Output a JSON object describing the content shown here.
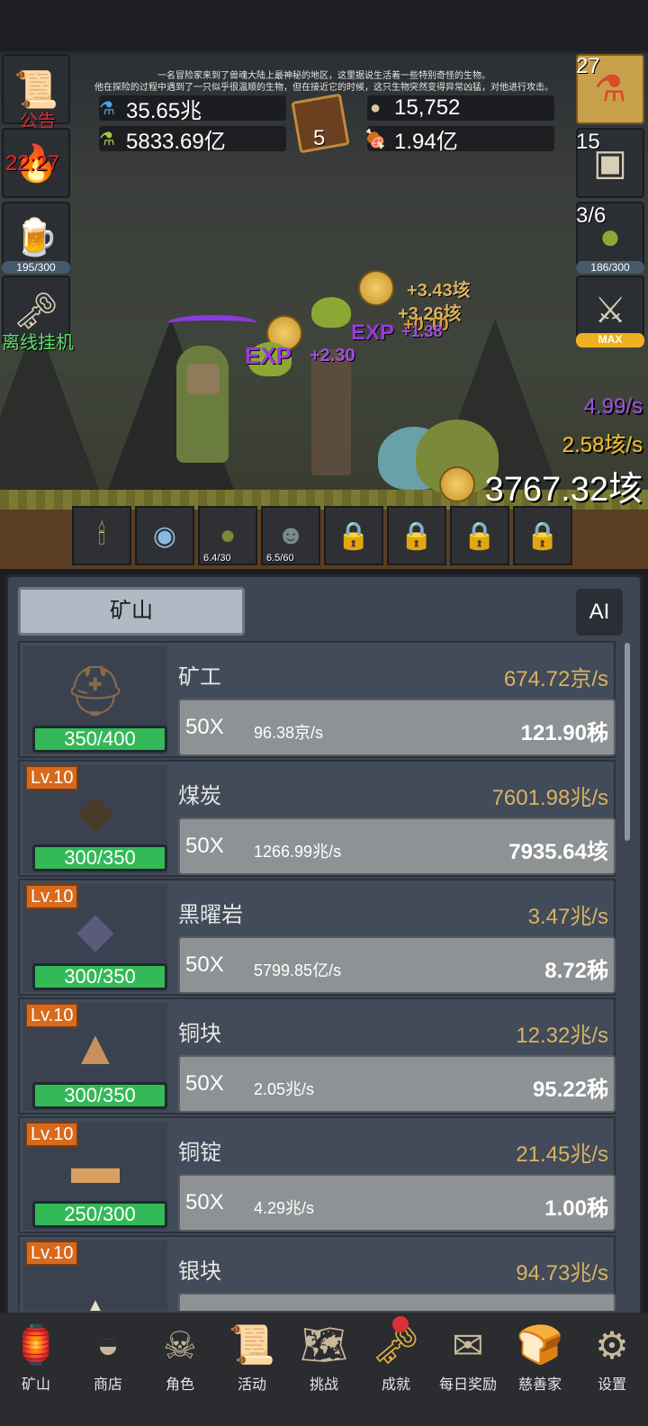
{
  "story": {
    "line1": "一名冒险家来到了兽魂大陆上最神秘的地区，这里据说生活着一些特别奇怪的生物。",
    "line2": "他在探险的过程中遇到了一只似乎很温顺的生物，但在接近它的时候，这只生物突然变得异常凶猛，对他进行攻击。"
  },
  "resources": {
    "blue_potion": "35.65兆",
    "green_potion": "5833.69亿",
    "coin": "15,752",
    "meat": "1.94亿",
    "book_count": "5"
  },
  "left_buttons": {
    "notice_label": "公告",
    "timer": "22:27",
    "beer_progress": "195/300",
    "offline_label": "离线挂机"
  },
  "right_buttons": {
    "potion_count": "27",
    "chest_count": "15",
    "slime_count": "3/6",
    "slime_progress": "186/300",
    "sword_max": "MAX"
  },
  "battle": {
    "exp_rate": "4.99/s",
    "gold_rate": "2.58垓/s",
    "gold_total": "3767.32垓",
    "floats": [
      {
        "text": "+3.43垓",
        "color": "#d9b262"
      },
      {
        "text": "+3.26垓",
        "color": "#d9b262"
      },
      {
        "text": "+0.10",
        "color": "#e09a3a"
      },
      {
        "text": "+1.38",
        "color": "#a050e0"
      },
      {
        "text": "+2.30",
        "color": "#a050e0"
      },
      {
        "text": "EXP",
        "color": "#9a3ae0"
      }
    ]
  },
  "slots": [
    {
      "icon": "candle-icon",
      "caption": ""
    },
    {
      "icon": "egg-icon",
      "caption": ""
    },
    {
      "icon": "slime-icon",
      "caption": "6.4/30"
    },
    {
      "icon": "zombie-icon",
      "caption": "6.5/60"
    },
    {
      "icon": "lock-icon",
      "caption": ""
    },
    {
      "icon": "lock-icon",
      "caption": ""
    },
    {
      "icon": "lock-icon",
      "caption": ""
    },
    {
      "icon": "lock-icon",
      "caption": ""
    }
  ],
  "panel": {
    "title": "矿山",
    "ai_label": "AI",
    "rows": [
      {
        "level": "",
        "name": "矿工",
        "production": "674.72京/s",
        "capacity": "350/400",
        "multiplier": "50X",
        "gain": "96.38京/s",
        "cost": "121.90秭"
      },
      {
        "level": "Lv.10",
        "name": "煤炭",
        "production": "7601.98兆/s",
        "capacity": "300/350",
        "multiplier": "50X",
        "gain": "1266.99兆/s",
        "cost": "7935.64垓"
      },
      {
        "level": "Lv.10",
        "name": "黑曜岩",
        "production": "3.47兆/s",
        "capacity": "300/350",
        "multiplier": "50X",
        "gain": "5799.85亿/s",
        "cost": "8.72秭"
      },
      {
        "level": "Lv.10",
        "name": "铜块",
        "production": "12.32兆/s",
        "capacity": "300/350",
        "multiplier": "50X",
        "gain": "2.05兆/s",
        "cost": "95.22秭"
      },
      {
        "level": "Lv.10",
        "name": "铜锭",
        "production": "21.45兆/s",
        "capacity": "250/300",
        "multiplier": "50X",
        "gain": "4.29兆/s",
        "cost": "1.00秭"
      },
      {
        "level": "Lv.10",
        "name": "银块",
        "production": "94.73兆/s",
        "capacity": "",
        "multiplier": "",
        "gain": "",
        "cost": ""
      }
    ]
  },
  "nav": [
    {
      "label": "矿山",
      "icon": "lantern-icon"
    },
    {
      "label": "商店",
      "icon": "stone-icon"
    },
    {
      "label": "角色",
      "icon": "skull-icon"
    },
    {
      "label": "活动",
      "icon": "scroll-icon"
    },
    {
      "label": "挑战",
      "icon": "map-icon"
    },
    {
      "label": "成就",
      "icon": "key-icon",
      "badge": true
    },
    {
      "label": "每日奖励",
      "icon": "envelope-icon"
    },
    {
      "label": "慈善家",
      "icon": "bread-icon"
    },
    {
      "label": "设置",
      "icon": "gear-icon"
    }
  ],
  "colors": {
    "gold_text": "#d9b262",
    "exp_purple": "#a050e0",
    "capacity_green": "#33b957",
    "level_orange": "#d86a1e",
    "panel_bg": "#3e4653"
  }
}
